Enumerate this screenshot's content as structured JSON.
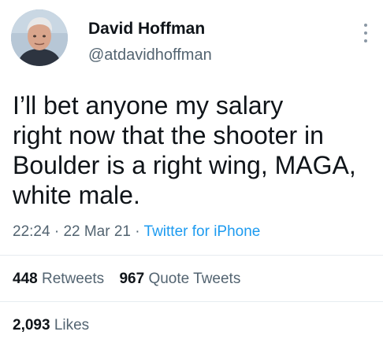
{
  "tweet": {
    "author": {
      "display_name": "David Hoffman",
      "handle": "@atdavidhoffman",
      "avatar_icon": "user-avatar"
    },
    "text": "I’ll bet anyone my salary\nright now that the shooter in\nBoulder is a right wing, MAGA,\nwhite male.",
    "time": "22:24",
    "separator": "·",
    "date": "22 Mar 21",
    "source": "Twitter for iPhone",
    "stats": {
      "retweets_count": "448",
      "retweets_label": "Retweets",
      "quote_tweets_count": "967",
      "quote_tweets_label": "Quote Tweets",
      "likes_count": "2,093",
      "likes_label": "Likes"
    },
    "more_icon": "more-vertical-icon"
  },
  "colors": {
    "text_primary": "#0f1419",
    "text_secondary": "#536471",
    "link": "#1d9bf0",
    "divider": "#e6ecf0"
  }
}
